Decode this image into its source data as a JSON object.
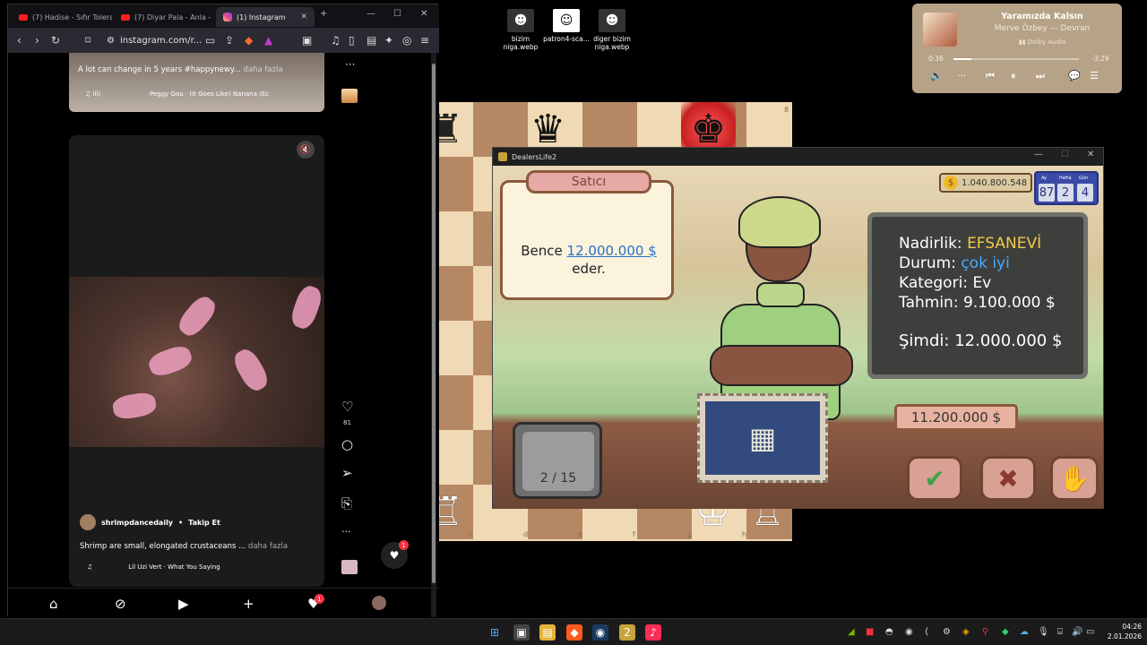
{
  "browser": {
    "tabs": [
      {
        "title": "(7) Hadise - Sıfır Tolera"
      },
      {
        "title": "(7) Diyar Pala - Anla - "
      },
      {
        "title": "(1) Instagram"
      }
    ],
    "url": "instagram.com/r..."
  },
  "instagram": {
    "post1": {
      "caption": "A lot can change in 5 years #happynewy...",
      "more": "daha fazla",
      "audio_label": "♫ iii)",
      "song": "Peggy Gou · (It Goes Like) Nanana (Ec"
    },
    "reel": {
      "username": "shrimpdancedaily",
      "follow_label": "Takip Et",
      "caption": "Shrimp are small, elongated crustaceans ...",
      "more": "daha fazla",
      "song": "Lil Uzi Vert · What You Saying",
      "likes": "81"
    },
    "notif_count": "1",
    "nav_badge": "1"
  },
  "desktop_icons": [
    {
      "name": "bizim niga.webp"
    },
    {
      "name": "patron4-sca..."
    },
    {
      "name": "diger bizim niga.webp"
    }
  ],
  "music": {
    "title": "Yaramızda Kalsın",
    "artist": "Merve Özbey — Devran",
    "dolby": "Dolby Audio",
    "elapsed": "0:36",
    "remaining": "-3:29",
    "progress": 0.14
  },
  "chess": {
    "rank_label": "8",
    "files": [
      "c",
      "d",
      "e",
      "f",
      "g",
      "h"
    ]
  },
  "game": {
    "window_title": "DealersLife2",
    "seller_tab": "Satıcı",
    "seller_line1": "Bence",
    "seller_price": "12.000.000 $",
    "seller_line2": "eder.",
    "money": "1.040.800.548",
    "date_labels": [
      "Ay",
      "Hafta",
      "Gün"
    ],
    "date_values": [
      "87",
      "2",
      "4"
    ],
    "info": {
      "rarity_label": "Nadirlik:",
      "rarity_value": "EFSANEVİ",
      "condition_label": "Durum:",
      "condition_value": "çok iyi",
      "category_label": "Kategori:",
      "category_value": "Ev",
      "estimate_label": "Tahmin:",
      "estimate_value": "9.100.000 $",
      "now_label": "Şimdi:",
      "now_value": "12.000.000 $"
    },
    "offer": "11.200.000 $",
    "counter": "2 / 15"
  },
  "clock": {
    "time": "04:26",
    "date": "2.01.2026"
  }
}
